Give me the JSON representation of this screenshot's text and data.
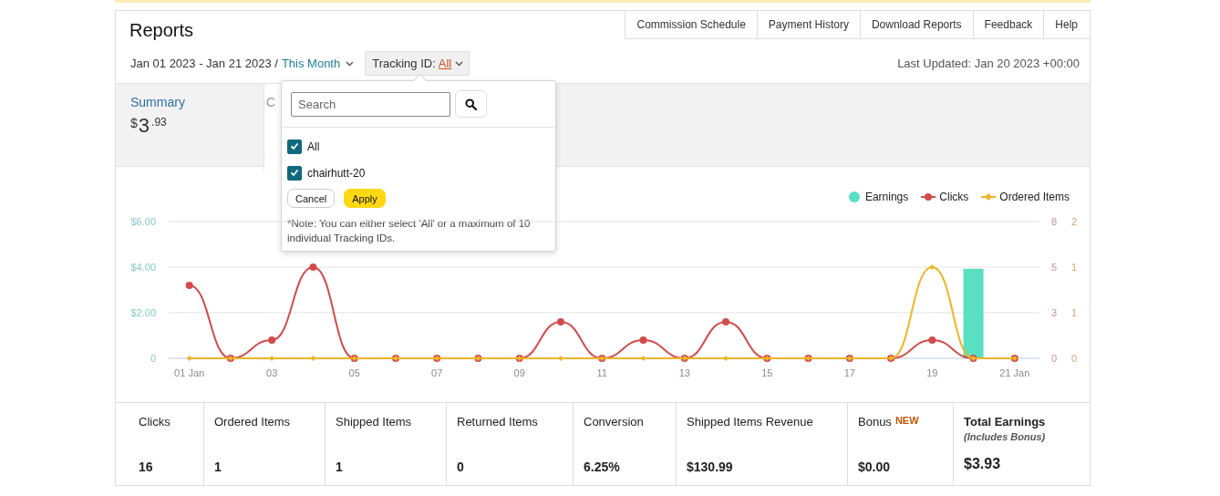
{
  "header": {
    "title": "Reports",
    "nav_tabs": [
      "Commission Schedule",
      "Payment History",
      "Download Reports",
      "Feedback",
      "Help"
    ]
  },
  "filters": {
    "date_range": "Jan 01 2023 - Jan 21 2023 /",
    "period": "This Month",
    "tracking_label": "Tracking ID:",
    "tracking_value": "All",
    "last_updated": "Last Updated: Jan 20 2023 +00:00"
  },
  "summary_tiles": [
    {
      "label": "Summary",
      "selected": true,
      "currency": "$",
      "whole": "3",
      "fraction": ".93"
    },
    {
      "label": "C",
      "selected": false
    }
  ],
  "tracking_dropdown": {
    "search": {
      "placeholder": "Search"
    },
    "options": [
      {
        "label": "All",
        "checked": true
      },
      {
        "label": "chairhutt-20",
        "checked": true
      }
    ],
    "buttons": [
      {
        "label": "Cancel",
        "kind": "secondary"
      },
      {
        "label": "Apply",
        "kind": "primary"
      }
    ],
    "note": "*Note: You can either select 'All' or a maximum of 10 individual Tracking IDs."
  },
  "chart": {
    "chart_data": {
      "type": "bar",
      "x": [
        1,
        2,
        3,
        4,
        5,
        6,
        7,
        8,
        9,
        10,
        11,
        12,
        13,
        14,
        15,
        16,
        17,
        18,
        19,
        20,
        21
      ],
      "xlim": [
        0.5,
        21.6
      ],
      "xticks": [
        {
          "value": 1,
          "label": "01 Jan"
        },
        {
          "value": 3,
          "label": "03"
        },
        {
          "value": 5,
          "label": "05"
        },
        {
          "value": 7,
          "label": "07"
        },
        {
          "value": 9,
          "label": "09"
        },
        {
          "value": 11,
          "label": "11"
        },
        {
          "value": 13,
          "label": "13"
        },
        {
          "value": 15,
          "label": "15"
        },
        {
          "value": 17,
          "label": "17"
        },
        {
          "value": 19,
          "label": "19"
        },
        {
          "value": 21,
          "label": "21 Jan"
        }
      ],
      "ylim": [
        0,
        6
      ],
      "yticks": [
        {
          "value": 0,
          "label": "0"
        },
        {
          "value": 2,
          "label": "$2.00"
        },
        {
          "value": 4,
          "label": "$4.00"
        },
        {
          "value": 6,
          "label": "$6.00"
        }
      ],
      "y2lim": [
        0,
        7.5
      ],
      "y2ticks": [
        {
          "value": 0,
          "label": "0"
        },
        {
          "value": 2.5,
          "label": "3"
        },
        {
          "value": 5,
          "label": "5"
        },
        {
          "value": 7.5,
          "label": "8"
        }
      ],
      "y3lim": [
        0,
        1.5
      ],
      "y3ticks": [
        {
          "value": 0,
          "label": "0"
        },
        {
          "value": 0.5,
          "label": "1"
        },
        {
          "value": 1,
          "label": "1"
        },
        {
          "value": 1.5,
          "label": "2"
        }
      ],
      "legend": "top-right",
      "series": [
        {
          "name": "Earnings",
          "color": "#58e0c1",
          "values": [
            0,
            0,
            0,
            0,
            0,
            0,
            0,
            0,
            0,
            0,
            0,
            0,
            0,
            0,
            0,
            0,
            0,
            0,
            0,
            3.93,
            0
          ]
        },
        {
          "name": "Clicks",
          "type": "line",
          "axis": "y2",
          "marker": "circle",
          "color": "#d24b4b",
          "values": [
            4,
            0,
            1,
            5,
            0,
            0,
            0,
            0,
            0,
            2,
            0,
            1,
            0,
            2,
            0,
            0,
            0,
            0,
            1,
            0,
            0
          ]
        },
        {
          "name": "Ordered Items",
          "type": "line",
          "axis": "y3",
          "marker": "diamond",
          "color": "#f0b429",
          "values": [
            0,
            0,
            0,
            0,
            0,
            0,
            0,
            0,
            0,
            0,
            0,
            0,
            0,
            0,
            0,
            0,
            0,
            0,
            1,
            0,
            0
          ]
        }
      ]
    }
  },
  "stats": [
    {
      "label": "Clicks",
      "value": "16"
    },
    {
      "label": "Ordered Items",
      "value": "1"
    },
    {
      "label": "Shipped Items",
      "value": "1"
    },
    {
      "label": "Returned Items",
      "value": "0"
    },
    {
      "label": "Conversion",
      "value": "6.25%"
    },
    {
      "label": "Shipped Items Revenue",
      "value": "$130.99"
    },
    {
      "label": "Bonus",
      "badge": "NEW",
      "value": "$0.00"
    },
    {
      "label": "Total Earnings",
      "note": "(Includes Bonus)",
      "emphasis": true,
      "value": "$3.93"
    }
  ]
}
